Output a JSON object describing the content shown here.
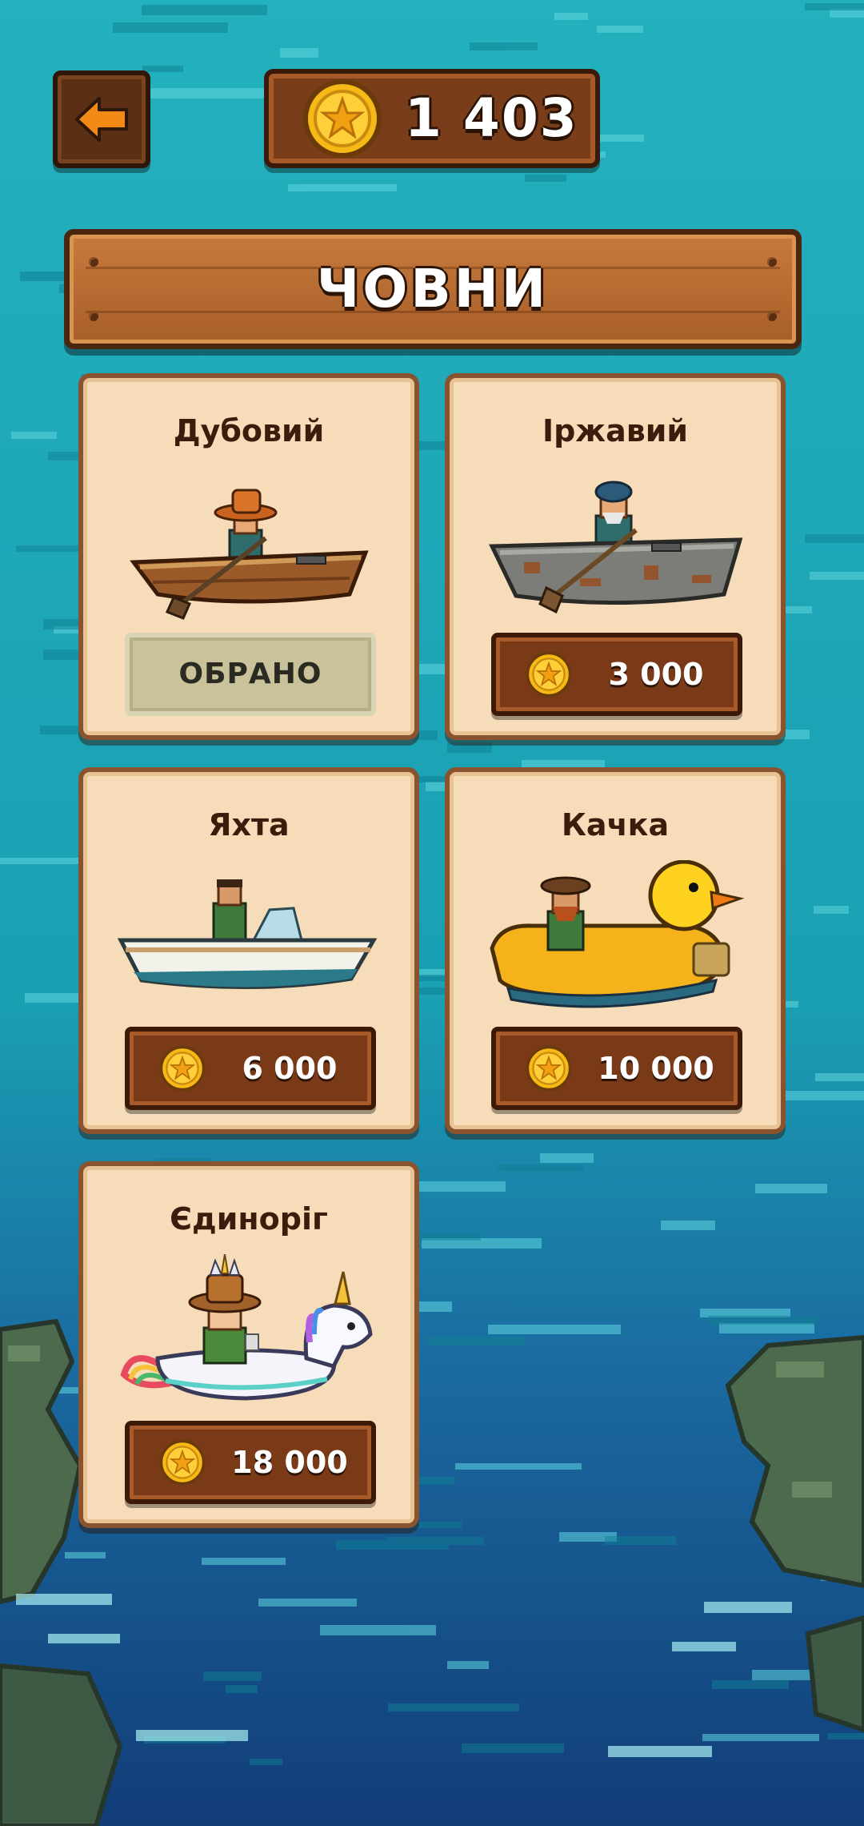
{
  "header": {
    "back_icon": "arrow-left-icon",
    "coin_icon": "gold-coin-icon",
    "balance": "1 403"
  },
  "title": "ЧОВНИ",
  "boats": [
    {
      "name": "Дубовий",
      "status": "ОБРАНО",
      "selected": true,
      "icon": "wooden-rowboat-icon"
    },
    {
      "name": "Іржавий",
      "price": "3 000",
      "selected": false,
      "icon": "rusty-boat-icon"
    },
    {
      "name": "Яхта",
      "price": "6 000",
      "selected": false,
      "icon": "motor-yacht-icon"
    },
    {
      "name": "Качка",
      "price": "10 000",
      "selected": false,
      "icon": "duck-float-icon"
    },
    {
      "name": "Єдиноріг",
      "price": "18 000",
      "selected": false,
      "icon": "unicorn-float-icon"
    }
  ],
  "colors": {
    "water": "#1faab5",
    "wood": "#7a3a18",
    "card": "#f6dcb8",
    "selected_button": "#c9c29a",
    "coin": "#f7b916"
  }
}
